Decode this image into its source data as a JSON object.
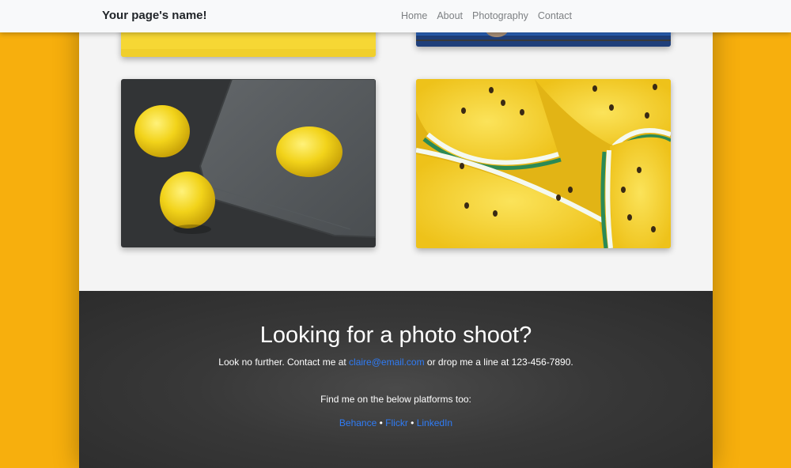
{
  "navbar": {
    "brand": "Your page's name!",
    "links": [
      "Home",
      "About",
      "Photography",
      "Contact"
    ]
  },
  "photos": [
    {
      "subject": "yellow-paper"
    },
    {
      "subject": "blue-scene"
    },
    {
      "subject": "lemons-on-slate"
    },
    {
      "subject": "yellow-watermelon"
    }
  ],
  "footer": {
    "heading": "Looking for a photo shoot?",
    "contact_prefix": "Look no further. Contact me at ",
    "email": "claire@email.com",
    "contact_suffix": " or drop me a line at 123-456-7890.",
    "platforms_text": "Find me on the below platforms too:",
    "socials": [
      "Behance",
      "Flickr",
      "LinkedIn"
    ],
    "separator": " • "
  },
  "colors": {
    "background": "#f7af0d",
    "footer": "#333333",
    "link": "#2f7cf6"
  }
}
